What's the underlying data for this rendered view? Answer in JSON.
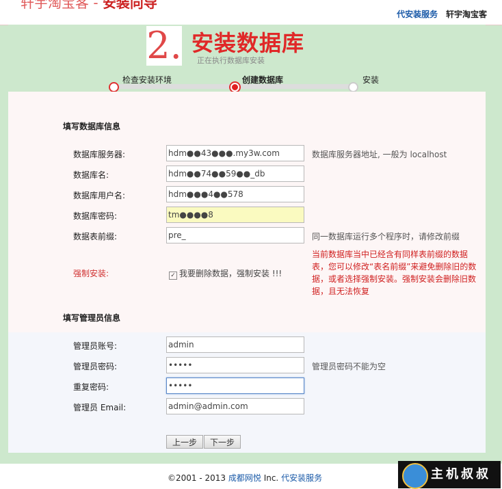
{
  "topbar": {
    "logo_cut_a": "轩宇淘宝客 - ",
    "logo_cut_b": "安装向导",
    "link_service": "代安装服务",
    "brand": "轩宇淘宝客"
  },
  "header": {
    "step_number": "2.",
    "title": "安装数据库",
    "subtitle": "正在执行数据库安装",
    "steps": [
      "检查安装环境",
      "创建数据库",
      "安装"
    ]
  },
  "db_section": {
    "title": "填写数据库信息",
    "fields": [
      {
        "label": "数据库服务器:",
        "value": "hdm●●43●●●.my3w.com",
        "hint": "数据库服务器地址, 一般为 localhost"
      },
      {
        "label": "数据库名:",
        "value": "hdm●●74●●59●●_db",
        "hint": ""
      },
      {
        "label": "数据库用户名:",
        "value": "hdm●●●4●●578",
        "hint": ""
      },
      {
        "label": "数据库密码:",
        "value": "tm●●●●8",
        "hint": ""
      },
      {
        "label": "数据表前缀:",
        "value": "pre_",
        "hint": "同一数据库运行多个程序时，请修改前缀"
      }
    ],
    "force_label": "强制安装:",
    "force_check_label": "我要删除数据，强制安装 !!!",
    "force_warning": "当前数据库当中已经含有同样表前缀的数据表，您可以修改“表名前缀”来避免删除旧的数据，或者选择强制安装。强制安装会删除旧数据，且无法恢复"
  },
  "admin_section": {
    "title": "填写管理员信息",
    "fields": [
      {
        "label": "管理员账号:",
        "value": "admin",
        "hint": ""
      },
      {
        "label": "管理员密码:",
        "value": "•••••",
        "hint": "管理员密码不能为空"
      },
      {
        "label": "重复密码:",
        "value": "•••••",
        "hint": ""
      },
      {
        "label": "管理员 Email:",
        "value": "admin@admin.com",
        "hint": ""
      }
    ]
  },
  "buttons": {
    "prev": "上一步",
    "next": "下一步"
  },
  "footer": {
    "copyright": "©2001 - 2013 ",
    "company": "成都网悦",
    "inc": " Inc. ",
    "service": "代安装服务"
  },
  "watermark": {
    "text": "主机叔叔"
  }
}
